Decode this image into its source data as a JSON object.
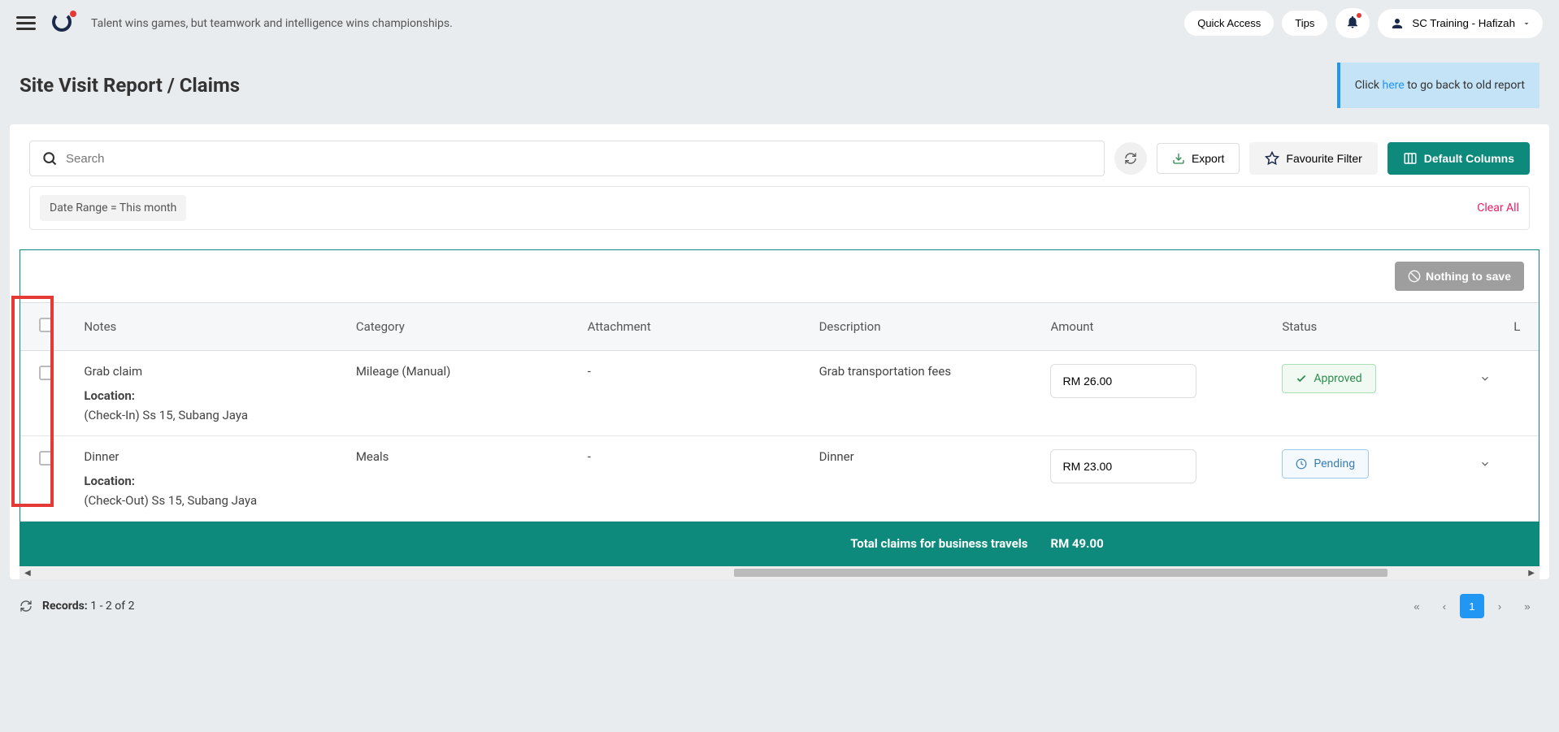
{
  "header": {
    "tagline": "Talent wins games, but teamwork and intelligence wins championships.",
    "quick_access": "Quick Access",
    "tips": "Tips",
    "user_name": "SC Training - Hafizah"
  },
  "page": {
    "title": "Site Visit Report / Claims",
    "info_prefix": "Click ",
    "info_link": "here",
    "info_suffix": " to go back to old report"
  },
  "toolbar": {
    "search_placeholder": "Search",
    "export": "Export",
    "favourite_filter": "Favourite Filter",
    "default_columns": "Default Columns"
  },
  "filters": {
    "chip": "Date Range  =  This month",
    "clear_all": "Clear All"
  },
  "table": {
    "nothing_to_save": "Nothing to save",
    "columns": {
      "notes": "Notes",
      "category": "Category",
      "attachment": "Attachment",
      "description": "Description",
      "amount": "Amount",
      "status": "Status",
      "last": "L"
    },
    "rows": [
      {
        "notes_title": "Grab claim",
        "location_label": "Location:",
        "location_value": "(Check-In) Ss 15, Subang Jaya",
        "category": "Mileage (Manual)",
        "attachment": "-",
        "description": "Grab transportation fees",
        "amount": "RM 26.00",
        "status": "Approved",
        "status_type": "approved"
      },
      {
        "notes_title": "Dinner",
        "location_label": "Location:",
        "location_value": "(Check-Out) Ss 15, Subang Jaya",
        "category": "Meals",
        "attachment": "-",
        "description": "Dinner",
        "amount": "RM 23.00",
        "status": "Pending",
        "status_type": "pending"
      }
    ],
    "total_label": "Total claims for business travels",
    "total_value": "RM 49.00"
  },
  "footer": {
    "records_label": "Records:",
    "records_value": "1 - 2   of   2",
    "current_page": "1"
  }
}
